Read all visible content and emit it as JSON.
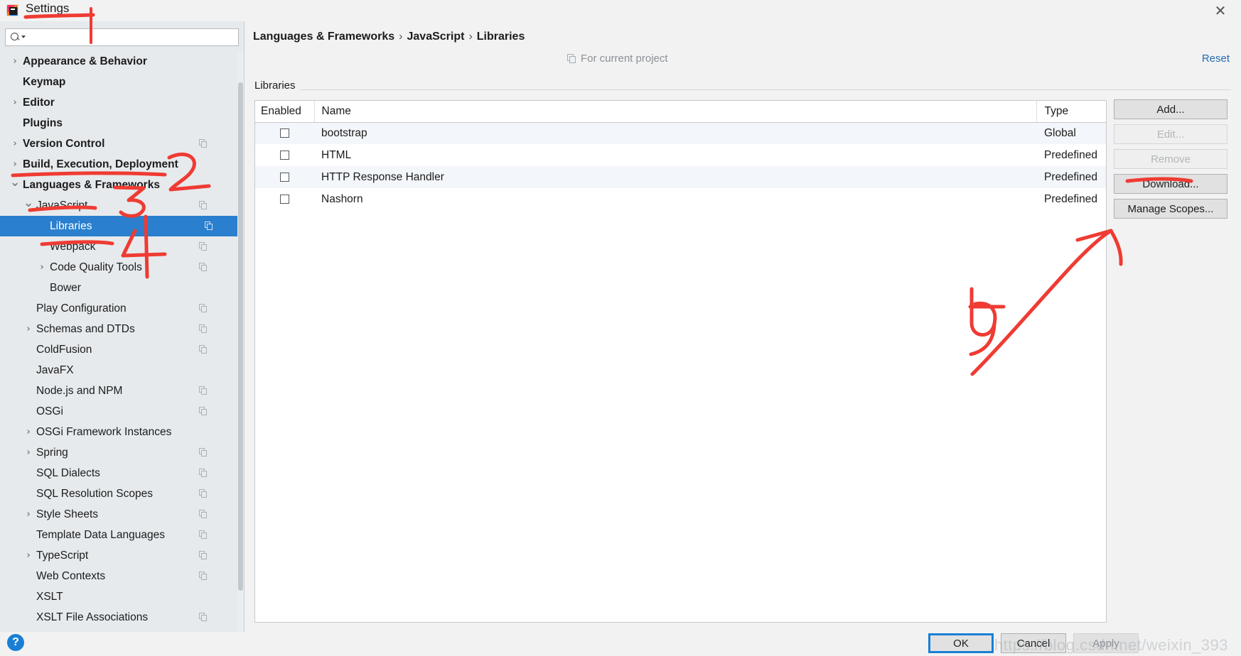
{
  "window": {
    "title": "Settings",
    "logo_icon": "intellij-idea-logo-icon",
    "close_icon": "close-icon"
  },
  "search": {
    "value": "",
    "placeholder": "",
    "icon": "search-icon"
  },
  "sidebar": {
    "items": [
      {
        "label": "Appearance & Behavior",
        "indent": 0,
        "chevron": "chevron-right-icon",
        "bold": true,
        "copy": false,
        "selected": false
      },
      {
        "label": "Keymap",
        "indent": 0,
        "chevron": "",
        "bold": true,
        "copy": false,
        "selected": false
      },
      {
        "label": "Editor",
        "indent": 0,
        "chevron": "chevron-right-icon",
        "bold": true,
        "copy": false,
        "selected": false
      },
      {
        "label": "Plugins",
        "indent": 0,
        "chevron": "",
        "bold": true,
        "copy": false,
        "selected": false
      },
      {
        "label": "Version Control",
        "indent": 0,
        "chevron": "chevron-right-icon",
        "bold": true,
        "copy": true,
        "selected": false
      },
      {
        "label": "Build, Execution, Deployment",
        "indent": 0,
        "chevron": "chevron-right-icon",
        "bold": true,
        "copy": false,
        "selected": false
      },
      {
        "label": "Languages & Frameworks",
        "indent": 0,
        "chevron": "chevron-down-icon",
        "bold": true,
        "copy": false,
        "selected": false
      },
      {
        "label": "JavaScript",
        "indent": 1,
        "chevron": "chevron-down-icon",
        "bold": false,
        "copy": true,
        "selected": false
      },
      {
        "label": "Libraries",
        "indent": 2,
        "chevron": "",
        "bold": false,
        "copy": true,
        "selected": true
      },
      {
        "label": "Webpack",
        "indent": 2,
        "chevron": "",
        "bold": false,
        "copy": true,
        "selected": false
      },
      {
        "label": "Code Quality Tools",
        "indent": 2,
        "chevron": "chevron-right-icon",
        "bold": false,
        "copy": true,
        "selected": false
      },
      {
        "label": "Bower",
        "indent": 2,
        "chevron": "",
        "bold": false,
        "copy": false,
        "selected": false
      },
      {
        "label": "Play Configuration",
        "indent": 1,
        "chevron": "",
        "bold": false,
        "copy": true,
        "selected": false
      },
      {
        "label": "Schemas and DTDs",
        "indent": 1,
        "chevron": "chevron-right-icon",
        "bold": false,
        "copy": true,
        "selected": false
      },
      {
        "label": "ColdFusion",
        "indent": 1,
        "chevron": "",
        "bold": false,
        "copy": true,
        "selected": false
      },
      {
        "label": "JavaFX",
        "indent": 1,
        "chevron": "",
        "bold": false,
        "copy": false,
        "selected": false
      },
      {
        "label": "Node.js and NPM",
        "indent": 1,
        "chevron": "",
        "bold": false,
        "copy": true,
        "selected": false
      },
      {
        "label": "OSGi",
        "indent": 1,
        "chevron": "",
        "bold": false,
        "copy": true,
        "selected": false
      },
      {
        "label": "OSGi Framework Instances",
        "indent": 1,
        "chevron": "chevron-right-icon",
        "bold": false,
        "copy": false,
        "selected": false
      },
      {
        "label": "Spring",
        "indent": 1,
        "chevron": "chevron-right-icon",
        "bold": false,
        "copy": true,
        "selected": false
      },
      {
        "label": "SQL Dialects",
        "indent": 1,
        "chevron": "",
        "bold": false,
        "copy": true,
        "selected": false
      },
      {
        "label": "SQL Resolution Scopes",
        "indent": 1,
        "chevron": "",
        "bold": false,
        "copy": true,
        "selected": false
      },
      {
        "label": "Style Sheets",
        "indent": 1,
        "chevron": "chevron-right-icon",
        "bold": false,
        "copy": true,
        "selected": false
      },
      {
        "label": "Template Data Languages",
        "indent": 1,
        "chevron": "",
        "bold": false,
        "copy": true,
        "selected": false
      },
      {
        "label": "TypeScript",
        "indent": 1,
        "chevron": "chevron-right-icon",
        "bold": false,
        "copy": true,
        "selected": false
      },
      {
        "label": "Web Contexts",
        "indent": 1,
        "chevron": "",
        "bold": false,
        "copy": true,
        "selected": false
      },
      {
        "label": "XSLT",
        "indent": 1,
        "chevron": "",
        "bold": false,
        "copy": false,
        "selected": false
      },
      {
        "label": "XSLT File Associations",
        "indent": 1,
        "chevron": "",
        "bold": false,
        "copy": true,
        "selected": false
      }
    ]
  },
  "header": {
    "breadcrumb": [
      "Languages & Frameworks",
      "JavaScript",
      "Libraries"
    ],
    "breadcrumb_separator": "›",
    "scope_label": "For current project",
    "scope_icon": "copy-scope-icon",
    "reset_label": "Reset"
  },
  "main": {
    "section_title": "Libraries",
    "table": {
      "columns": [
        "Enabled",
        "Name",
        "Type"
      ],
      "rows": [
        {
          "enabled": false,
          "name": "bootstrap",
          "type": "Global"
        },
        {
          "enabled": false,
          "name": "HTML",
          "type": "Predefined"
        },
        {
          "enabled": false,
          "name": "HTTP Response Handler",
          "type": "Predefined"
        },
        {
          "enabled": false,
          "name": "Nashorn",
          "type": "Predefined"
        }
      ]
    },
    "buttons": [
      {
        "label": "Add...",
        "disabled": false
      },
      {
        "label": "Edit...",
        "disabled": true
      },
      {
        "label": "Remove",
        "disabled": true
      },
      {
        "label": "Download...",
        "disabled": false
      },
      {
        "label": "Manage Scopes...",
        "disabled": false
      }
    ]
  },
  "footer": {
    "help_icon": "help-question-icon",
    "help_label": "?",
    "ok_label": "OK",
    "cancel_label": "Cancel",
    "apply_label": "Apply",
    "watermark": "https://blog.csdn.net/weixin_393"
  },
  "annotations": {
    "color": "#ef3b33",
    "marks": [
      {
        "name": "underline-settings-title",
        "text": ""
      },
      {
        "name": "vertical-stroke-near-title",
        "text": ""
      },
      {
        "name": "number-2-mark",
        "text": "2"
      },
      {
        "name": "underline-languages-frameworks",
        "text": ""
      },
      {
        "name": "number-3-mark",
        "text": "3"
      },
      {
        "name": "underline-javascript",
        "text": ""
      },
      {
        "name": "number-4-mark",
        "text": "4"
      },
      {
        "name": "underline-webpack",
        "text": ""
      },
      {
        "name": "underline-download-button",
        "text": ""
      },
      {
        "name": "arrow-to-manage-scopes",
        "text": ""
      },
      {
        "name": "number-5-mark",
        "text": "5"
      }
    ]
  },
  "colors": {
    "selection_blue": "#2a7fce",
    "accent_blue": "#1a7fd4",
    "link_blue": "#246ab2",
    "annotation_red": "#ef3b33",
    "sidebar_bg": "#e6eaed",
    "panel_bg": "#f2f2f2"
  }
}
